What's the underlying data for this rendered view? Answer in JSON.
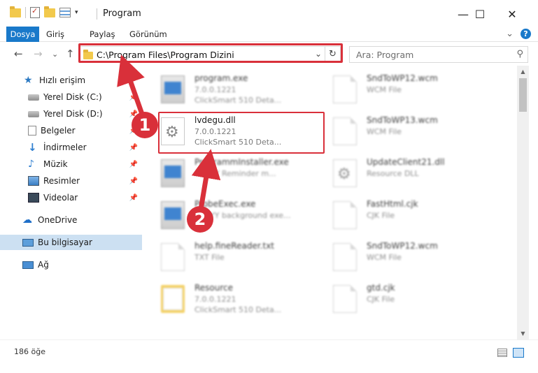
{
  "window": {
    "title": "Program",
    "minimize": "—",
    "maximize": "☐",
    "close": "✕"
  },
  "ribbon": {
    "tabs": [
      "Dosya",
      "Giriş",
      "Paylaş",
      "Görünüm"
    ],
    "expand": "⌄",
    "help": "?"
  },
  "nav": {
    "back": "←",
    "forward": "→",
    "recent": "⌄",
    "up": "↑",
    "address": "C:\\Program Files\\Program Dizini",
    "address_dropdown": "⌄",
    "refresh": "↻",
    "search_placeholder": "Ara: Program",
    "search_icon": "⚲"
  },
  "sidebar": {
    "items": [
      {
        "label": "Hızlı erişim",
        "icon": "star-icon"
      },
      {
        "label": "Yerel Disk (C:)",
        "icon": "disk-icon",
        "pinned": true
      },
      {
        "label": "Yerel Disk (D:)",
        "icon": "disk-icon",
        "pinned": true
      },
      {
        "label": "Belgeler",
        "icon": "document-icon",
        "pinned": true
      },
      {
        "label": "İndirmeler",
        "icon": "download-icon",
        "pinned": true
      },
      {
        "label": "Müzik",
        "icon": "music-icon",
        "pinned": true
      },
      {
        "label": "Resimler",
        "icon": "pictures-icon",
        "pinned": true
      },
      {
        "label": "Videolar",
        "icon": "videos-icon",
        "pinned": true
      },
      {
        "label": "OneDrive",
        "icon": "cloud-icon"
      },
      {
        "label": "Bu bilgisayar",
        "icon": "computer-icon",
        "selected": true
      },
      {
        "label": "Ağ",
        "icon": "network-icon"
      }
    ]
  },
  "files": {
    "left": [
      {
        "name": "program.exe",
        "l1": "7.0.0.1221",
        "l2": "ClickSmart 510 Deta...",
        "kind": "exe"
      },
      {
        "name": "lvdegu.dll",
        "l1": "7.0.0.1221",
        "l2": "ClickSmart 510 Deta...",
        "kind": "dll"
      },
      {
        "name": "ProgrammInstaller.exe",
        "l1": "ABBYY Reminder m...",
        "l2": "",
        "kind": "exe"
      },
      {
        "name": "ProbeExec.exe",
        "l1": "ABBYY background exe...",
        "l2": "",
        "kind": "exe"
      },
      {
        "name": "help.fineReader.txt",
        "l1": "TXT File",
        "l2": "",
        "kind": "page"
      },
      {
        "name": "Resource",
        "l1": "7.0.0.1221",
        "l2": "ClickSmart 510 Deta...",
        "kind": "folder"
      }
    ],
    "right": [
      {
        "name": "SndToWP12.wcm",
        "l1": "WCM File",
        "kind": "page"
      },
      {
        "name": "SndToWP13.wcm",
        "l1": "WCM File",
        "kind": "page"
      },
      {
        "name": "UpdateClient21.dll",
        "l1": "Resource DLL",
        "kind": "dll"
      },
      {
        "name": "FastHtml.cjk",
        "l1": "CJK File",
        "kind": "page"
      },
      {
        "name": "SndToWP12.wcm",
        "l1": "WCM File",
        "kind": "page"
      },
      {
        "name": "gtd.cjk",
        "l1": "CJK File",
        "kind": "page"
      }
    ]
  },
  "callouts": {
    "step1": "1",
    "step2": "2"
  },
  "status": {
    "count": "186 öğe"
  },
  "colors": {
    "accent": "#1979ca",
    "highlight": "#d9303a",
    "selected": "#cce0f2"
  }
}
